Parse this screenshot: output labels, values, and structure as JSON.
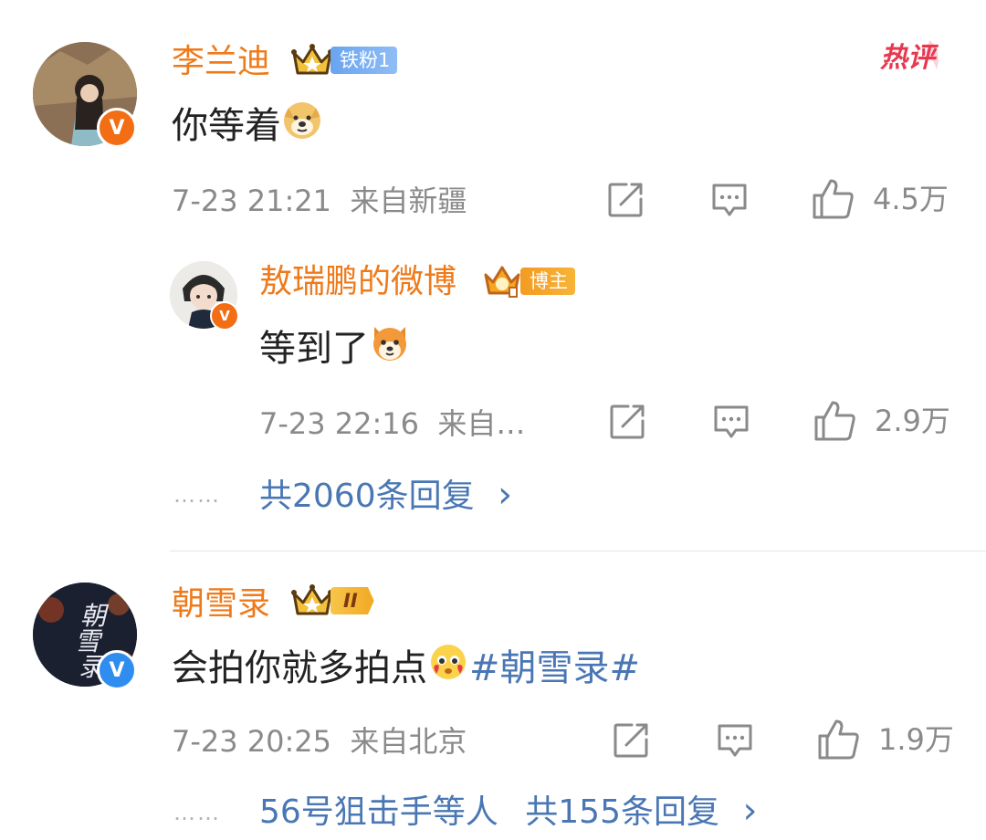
{
  "comments": [
    {
      "author": "李兰迪",
      "badge_label": "铁粉1",
      "hot_label": "热评",
      "text": "你等着",
      "emoji": "doge-emoji",
      "time": "7-23 21:21",
      "location": "来自新疆",
      "likes": "4.5万",
      "reply": {
        "author": "敖瑞鹏的微博",
        "badge_label": "博主",
        "text": "等到了",
        "emoji": "shiba-emoji",
        "time": "7-23 22:16",
        "location": "来自…",
        "likes": "2.9万"
      },
      "more": {
        "dots": "……",
        "label": "共2060条回复",
        "chevron": "›"
      }
    },
    {
      "author": "朝雪录",
      "badge_label": "II",
      "text": "会拍你就多拍点",
      "emoji": "pleading-heart-emoji",
      "hashtag": "#朝雪录#",
      "time": "7-23 20:25",
      "location": "来自北京",
      "likes": "1.9万",
      "more": {
        "dots": "……",
        "users": "56号狙击手等人",
        "label": "共155条回复",
        "chevron": "›"
      }
    }
  ],
  "colors": {
    "name_orange": "#ef7a1a",
    "link_blue": "#4a77b4",
    "meta_gray": "#8a8a8a",
    "hot_red": "#e8384f"
  },
  "icons": [
    "share-icon",
    "comment-icon",
    "like-icon",
    "crown-icon",
    "verified-v-icon"
  ]
}
